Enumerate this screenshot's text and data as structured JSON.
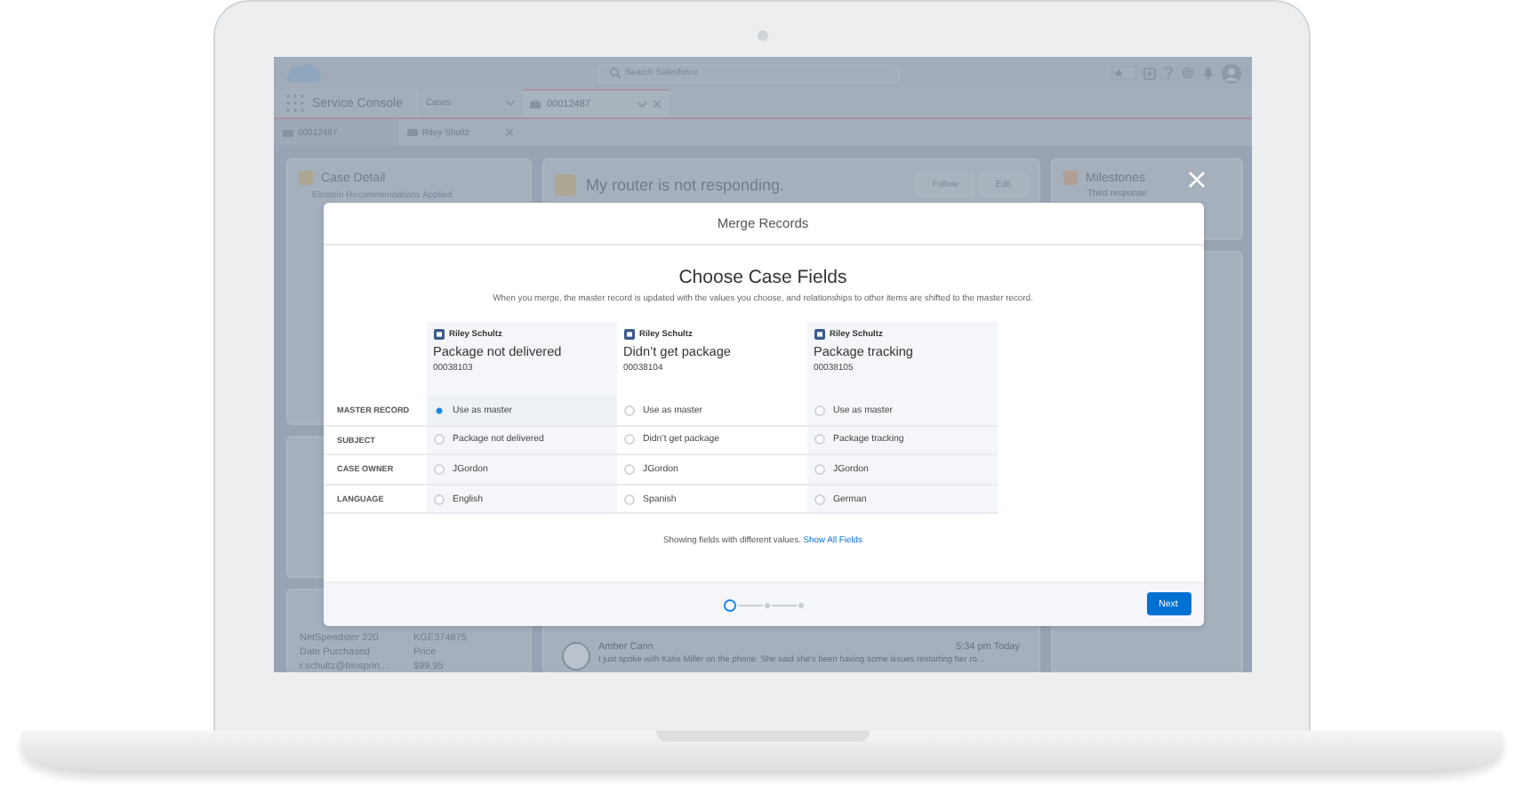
{
  "app": {
    "search": {
      "placeholder": "Search Salesforce"
    },
    "app_name": "Service Console",
    "object_picker": {
      "value": "Cases"
    },
    "tabs": [
      {
        "label": "00012487",
        "selected": true
      }
    ],
    "subtabs": [
      {
        "label": "00012487",
        "selected": true
      },
      {
        "label": "Riley Shultz",
        "selected": false
      }
    ],
    "case_detail": {
      "title": "Case Detail",
      "banner": "Einstein Recommendations Applied"
    },
    "product_card": {
      "rows": [
        [
          "NetSpeedster 220",
          "KGE374875"
        ],
        [
          "Date Purchased",
          "Price"
        ],
        [
          "r.schultz@biosprin...",
          "$99.95"
        ]
      ]
    },
    "case_header": {
      "title": "My router is not responding.",
      "buttons": [
        "Follow",
        "Edit"
      ]
    },
    "feed": [
      {
        "author": "Amber Cann",
        "time": "5:34 pm Today",
        "message": "I just spoke with Katie Miller on the phone. She said she's been having some issues restarting her ro..."
      }
    ],
    "milestones": {
      "title": "Milestones",
      "item": "Third response"
    }
  },
  "modal": {
    "title": "Merge Records",
    "heading": "Choose Case Fields",
    "description": "When you merge, the master record is updated with the values you choose, and relationships to other items are shifted to the master record.",
    "records": [
      {
        "owner": "Riley Schultz",
        "subject": "Package not delivered",
        "number": "00038103"
      },
      {
        "owner": "Riley Schultz",
        "subject": "Didn’t get package",
        "number": "00038104"
      },
      {
        "owner": "Riley Schultz",
        "subject": "Package tracking",
        "number": "00038105"
      }
    ],
    "fields": [
      {
        "label": "MASTER RECORD",
        "options": [
          {
            "text": "Use as master",
            "selected": true
          },
          {
            "text": "Use as master",
            "selected": false
          },
          {
            "text": "Use as master",
            "selected": false
          }
        ]
      },
      {
        "label": "SUBJECT",
        "options": [
          {
            "text": "Package not delivered",
            "selected": false
          },
          {
            "text": "Didn’t get package",
            "selected": false
          },
          {
            "text": "Package tracking",
            "selected": false
          }
        ]
      },
      {
        "label": "CASE OWNER",
        "options": [
          {
            "text": "JGordon",
            "selected": false
          },
          {
            "text": "JGordon",
            "selected": false
          },
          {
            "text": "JGordon",
            "selected": false
          }
        ]
      },
      {
        "label": "LANGUAGE",
        "options": [
          {
            "text": "English",
            "selected": false
          },
          {
            "text": "Spanish",
            "selected": false
          },
          {
            "text": "German",
            "selected": false
          }
        ]
      }
    ],
    "note": "Showing fields with different values.",
    "link": "Show All Fields",
    "steps": [
      {
        "selected": true
      },
      {
        "selected": false
      },
      {
        "selected": false
      }
    ],
    "next_button": "Next"
  }
}
